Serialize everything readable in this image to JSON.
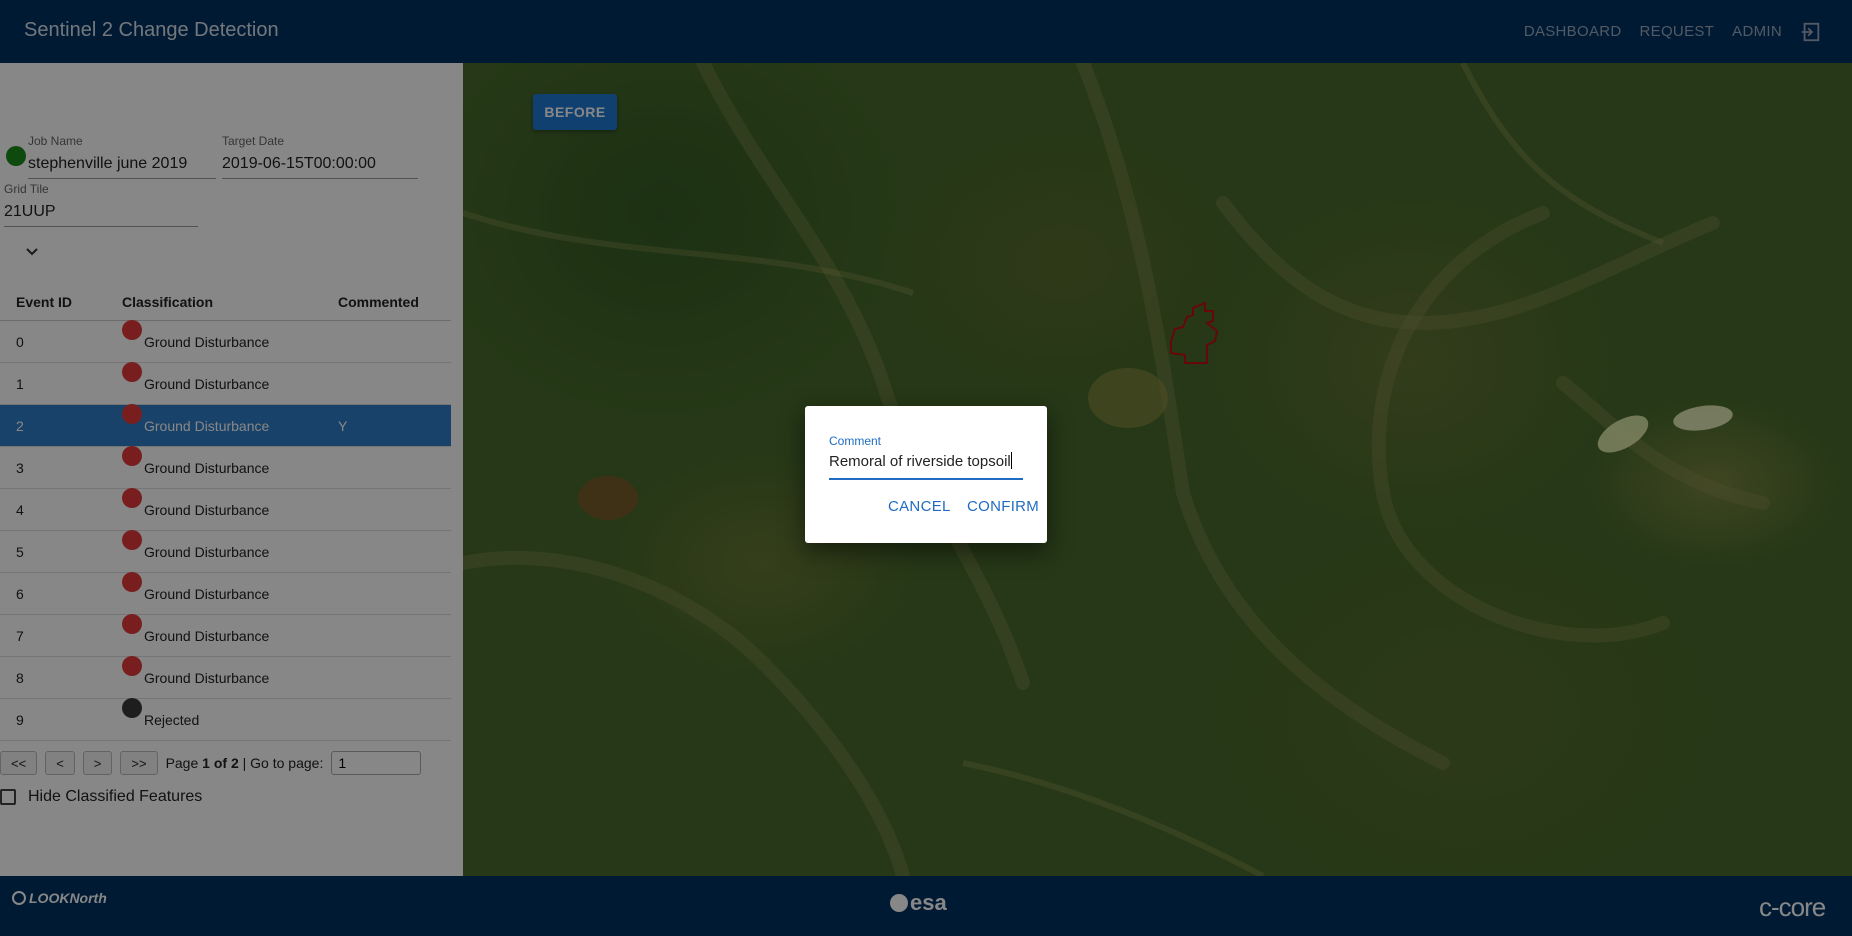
{
  "header": {
    "title": "Sentinel 2 Change Detection",
    "nav": [
      "DASHBOARD",
      "REQUEST",
      "ADMIN"
    ],
    "logout_icon": "logout-icon"
  },
  "job": {
    "job_name_label": "Job Name",
    "job_name": "stephenville june 2019",
    "target_date_label": "Target Date",
    "target_date": "2019-06-15T00:00:00",
    "grid_tile_label": "Grid Tile",
    "grid_tile": "21UUP",
    "status_color": "#1b8a1b"
  },
  "table": {
    "headers": [
      "Event ID",
      "Classification",
      "Commented"
    ],
    "rows": [
      {
        "id": "0",
        "classification": "Ground Disturbance",
        "commented": "",
        "dot": "red"
      },
      {
        "id": "1",
        "classification": "Ground Disturbance",
        "commented": "",
        "dot": "red"
      },
      {
        "id": "2",
        "classification": "Ground Disturbance",
        "commented": "Y",
        "dot": "red",
        "selected": true
      },
      {
        "id": "3",
        "classification": "Ground Disturbance",
        "commented": "",
        "dot": "red"
      },
      {
        "id": "4",
        "classification": "Ground Disturbance",
        "commented": "",
        "dot": "red"
      },
      {
        "id": "5",
        "classification": "Ground Disturbance",
        "commented": "",
        "dot": "red"
      },
      {
        "id": "6",
        "classification": "Ground Disturbance",
        "commented": "",
        "dot": "red"
      },
      {
        "id": "7",
        "classification": "Ground Disturbance",
        "commented": "",
        "dot": "red"
      },
      {
        "id": "8",
        "classification": "Ground Disturbance",
        "commented": "",
        "dot": "red"
      },
      {
        "id": "9",
        "classification": "Rejected",
        "commented": "",
        "dot": "gray"
      }
    ]
  },
  "pager": {
    "first": "<<",
    "prev": "<",
    "next": ">",
    "last": ">>",
    "page_word": "Page",
    "current": "1",
    "of_word": "of",
    "total": "2",
    "goto_label": "| Go to page:",
    "goto_value": "1"
  },
  "hide_classified": {
    "label": "Hide Classified Features",
    "checked": false
  },
  "map": {
    "before_label": "BEFORE"
  },
  "dialog": {
    "label": "Comment",
    "value": "Remoral of riverside topsoil",
    "cancel": "CANCEL",
    "confirm": "CONFIRM"
  },
  "footer": {
    "left_logo": "LOOKNorth",
    "center_logo": "esa",
    "right_logo": "c-core"
  },
  "colors": {
    "brand_navy": "#013263",
    "accent_blue": "#1f6cc2",
    "selected_row": "#2e7ec7",
    "disturbance": "#e23a3a",
    "rejected": "#3a3a3a"
  }
}
